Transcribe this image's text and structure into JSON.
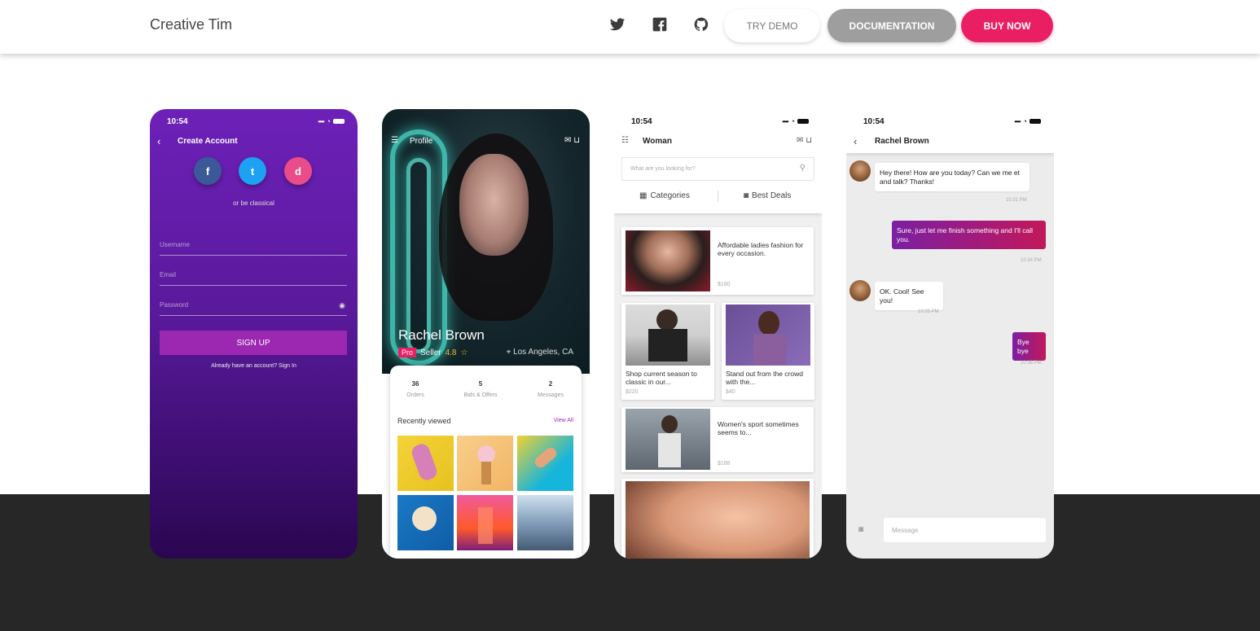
{
  "nav": {
    "brand": "Creative Tim",
    "icons": [
      "twitter-icon",
      "facebook-icon",
      "github-icon"
    ],
    "try_demo": "TRY DEMO",
    "documentation": "DOCUMENTATION",
    "buy_now": "BUY NOW"
  },
  "colors": {
    "accent": "#e91e63",
    "purple": "#9c27b0",
    "footer": "#272727"
  },
  "signup_screen": {
    "time": "10:54",
    "title": "Create Account",
    "social": [
      "f",
      "t",
      "d"
    ],
    "or_text": "or be classical",
    "username_placeholder": "Username",
    "email_placeholder": "Email",
    "password_placeholder": "Password",
    "signup_button": "SIGN UP",
    "signin_text": "Already have an account? Sign In"
  },
  "profile_screen": {
    "title": "Profile",
    "name": "Rachel Brown",
    "badge": "Pro",
    "role": "Seller",
    "rating": "4.8",
    "location": "Los Angeles, CA",
    "stats": [
      {
        "value": "36",
        "label": "Orders"
      },
      {
        "value": "5",
        "label": "Bids & Offers"
      },
      {
        "value": "2",
        "label": "Messages"
      }
    ],
    "recently_viewed": "Recently viewed",
    "view_all": "View All"
  },
  "shop_screen": {
    "time": "10:54",
    "title": "Woman",
    "search_placeholder": "What are you looking for?",
    "tab_categories": "Categories",
    "tab_deals": "Best Deals",
    "products": [
      {
        "desc": "Affordable ladies fashion for every occasion.",
        "price": "$180"
      },
      {
        "desc": "Shop current season to classic in our...",
        "price": "$220"
      },
      {
        "desc": "Stand out from the crowd with the...",
        "price": "$40"
      },
      {
        "desc": "Women's sport sometimes seems to...",
        "price": "$188"
      }
    ]
  },
  "chat_screen": {
    "time": "10:54",
    "title": "Rachel Brown",
    "messages": [
      {
        "text": "Hey there! How are you today? Can we me et and talk? Thanks!",
        "time": "10:31 PM"
      },
      {
        "text": "Sure, just let me finish something and I'll call you.",
        "time": "10:34 PM"
      },
      {
        "text": "OK. Cool! See you!",
        "time": "10:35 PM"
      },
      {
        "text": "Bye bye",
        "time": "10:36 PM"
      }
    ],
    "message_placeholder": "Message"
  }
}
